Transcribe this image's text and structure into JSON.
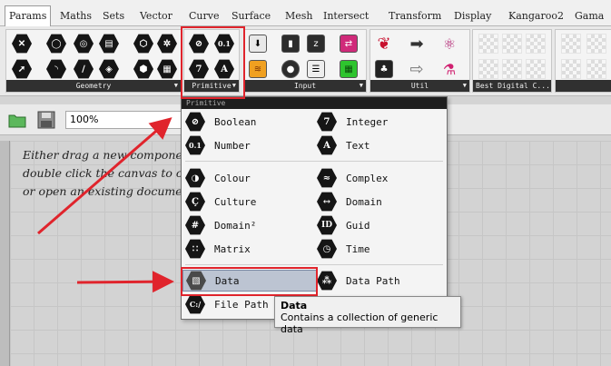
{
  "tabs": [
    "Params",
    "Maths",
    "Sets",
    "Vector",
    "Curve",
    "Surface",
    "Mesh",
    "Intersect",
    "Transform",
    "Display",
    "Kangaroo2",
    "Gama"
  ],
  "ribbon": {
    "panels": [
      {
        "label": "Geometry"
      },
      {
        "label": "Primitive"
      },
      {
        "label": "Input"
      },
      {
        "label": "Util"
      },
      {
        "label": "Best Digital C..."
      }
    ],
    "primitive_icons": [
      "⊘",
      "0.1",
      "7",
      "A"
    ]
  },
  "toolbar": {
    "zoom": "100%"
  },
  "canvas": {
    "hint_lines": [
      "Either drag a new component onto the canvas, or",
      "double click the canvas to create a component,",
      "or open an existing document."
    ]
  },
  "dropdown": {
    "header": "Primitive",
    "items": [
      {
        "label": "Boolean",
        "glyph": "⊘"
      },
      {
        "label": "Integer",
        "glyph": "7"
      },
      {
        "label": "Number",
        "glyph": "0.1"
      },
      {
        "label": "Text",
        "glyph": "A"
      },
      {
        "label": "Colour",
        "glyph": "◑"
      },
      {
        "label": "Complex",
        "glyph": "≈"
      },
      {
        "label": "Culture",
        "glyph": "Ç"
      },
      {
        "label": "Domain",
        "glyph": "↔"
      },
      {
        "label": "Domain²",
        "glyph": "#"
      },
      {
        "label": "Guid",
        "glyph": "ID"
      },
      {
        "label": "Matrix",
        "glyph": "∷"
      },
      {
        "label": "Time",
        "glyph": "◷"
      },
      {
        "label": "Data",
        "glyph": "▧"
      },
      {
        "label": "Data Path",
        "glyph": "⁂"
      },
      {
        "label": "File Path",
        "glyph": "C:/"
      }
    ]
  },
  "tooltip": {
    "title": "Data",
    "description": "Contains a collection of generic data"
  },
  "colors": {
    "highlight": "#e0242c",
    "selection": "#bcc4d2"
  }
}
